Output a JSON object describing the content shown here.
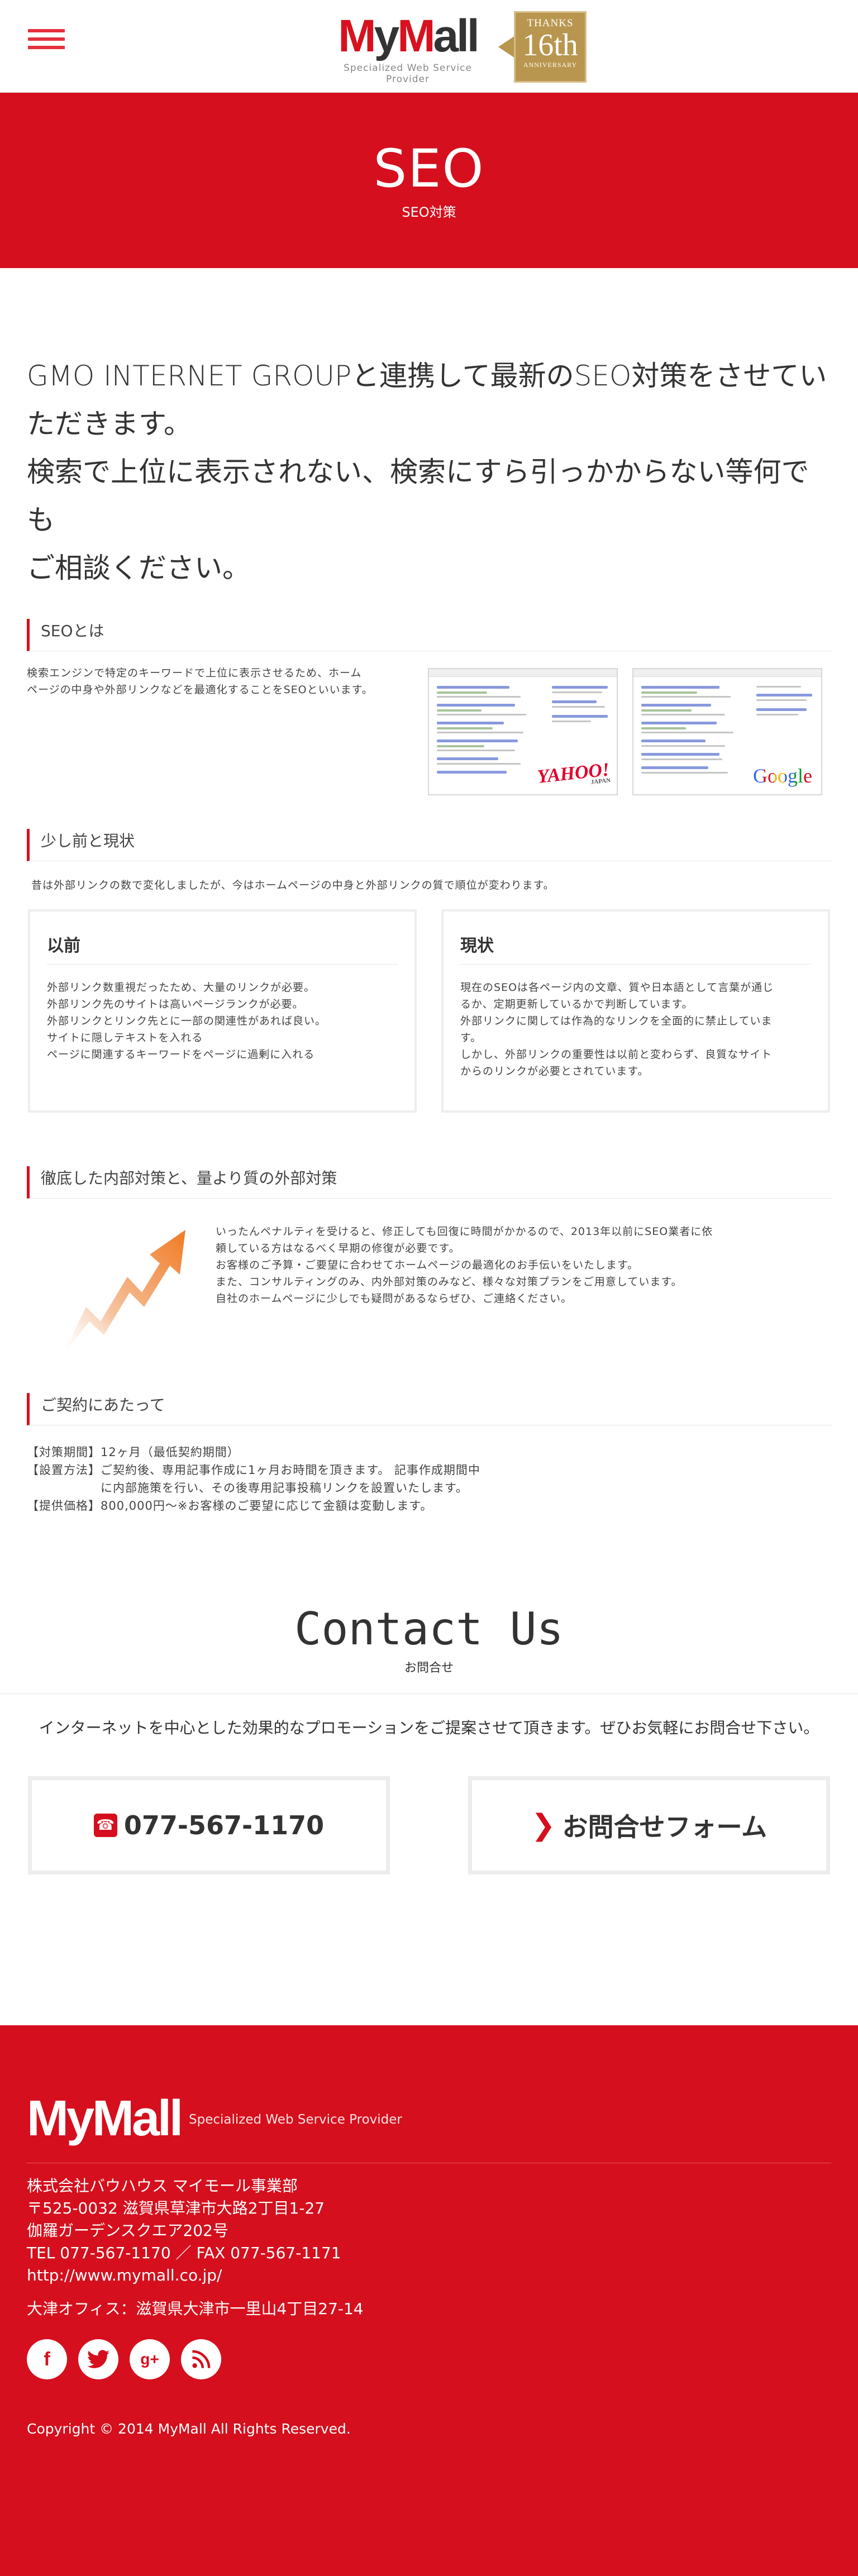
{
  "header": {
    "logo_text": "MyMall",
    "logo_sub": "Specialized Web Service Provider",
    "badge_line1": "THANKS",
    "badge_line2": "16th",
    "badge_line3": "ANNIVERSARY"
  },
  "hero": {
    "title": "SEO",
    "subtitle": "SEO対策"
  },
  "intro": {
    "line1": "GMO INTERNET GROUPと連携して最新のSEO対策をさせてい",
    "line2": "ただきます。",
    "line3": "検索で上位に表示されない、検索にすら引っかからない等何でも",
    "line4": "ご相談ください。"
  },
  "section_seo": {
    "title": "SEOとは",
    "line1": "検索エンジンで特定のキーワードで上位に表示させるため、ホーム",
    "line2": "ページの中身や外部リンクなどを最適化することをSEOといいます。",
    "yahoo_label": "YAHOO!",
    "yahoo_sub": "JAPAN",
    "google_label": "Google"
  },
  "section_now": {
    "title": "少し前と現状",
    "lead": "昔は外部リンクの数で変化しましたが、今はホームページの中身と外部リンクの質で順位が変わります。",
    "before": {
      "title": "以前",
      "lines": [
        "外部リンク数重視だったため、大量のリンクが必要。",
        "外部リンク先のサイトは高いページランクが必要。",
        "外部リンクとリンク先とに一部の関連性があれば良い。",
        "サイトに隠しテキストを入れる",
        "ページに関連するキーワードをページに過剰に入れる"
      ]
    },
    "current": {
      "title": "現状",
      "lines": [
        "現在のSEOは各ページ内の文章、質や日本語として言葉が通じ",
        "るか、定期更新しているかで判断しています。",
        "外部リンクに関しては作為的なリンクを全面的に禁止していま",
        "す。",
        "しかし、外部リンクの重要性は以前と変わらず、良質なサイト",
        "からのリンクが必要とされています。"
      ]
    }
  },
  "section_measures": {
    "title": "徹底した内部対策と、量より質の外部対策",
    "lines": [
      "いったんペナルティを受けると、修正しても回復に時間がかかるので、2013年以前にSEO業者に依",
      "頼している方はなるべく早期の修復が必要です。",
      "お客様のご予算・ご要望に合わせてホームページの最適化のお手伝いをいたします。",
      "また、コンサルティングのみ、内外部対策のみなど、様々な対策プランをご用意しています。",
      "自社のホームページに少しでも疑問があるならぜひ、ご連絡ください。"
    ]
  },
  "section_contract": {
    "title": "ご契約にあたって",
    "lines": [
      "【対策期間】12ヶ月（最低契約期間）",
      "【設置方法】ご契約後、専用記事作成に1ヶ月お時間を頂きます。 記事作成期間中",
      "　　　　　　に内部施策を行い、その後専用記事投稿リンクを設置いたします。",
      "【提供価格】800,000円〜※お客様のご要望に応じて金額は変動します。"
    ]
  },
  "contact": {
    "title": "Contact Us",
    "subtitle": "お問合せ",
    "lead": "インターネットを中心とした効果的なプロモーションをご提案させて頂きます。ぜひお気軽にお問合せ下さい。",
    "phone_label": "077-567-1170",
    "form_label": "お問合せフォーム"
  },
  "footer": {
    "logo_text": "MyMall",
    "tagline": "Specialized Web Service Provider",
    "address": [
      "株式会社バウハウス マイモール事業部",
      "〒525-0032 滋賀県草津市大路2丁目1-27",
      "伽羅ガーデンスクエア202号",
      "TEL 077-567-1170 ／ FAX 077-567-1171",
      "http://www.mymall.co.jp/"
    ],
    "office": "大津オフィス：滋賀県大津市一里山4丁目27-14",
    "copyright": "Copyright © 2014 MyMall All Rights Reserved."
  },
  "colors": {
    "brand_red": "#d50f1d",
    "badge_gold": "#b9964f"
  },
  "icons": [
    "menu-icon",
    "phone-icon",
    "chevron-right-icon",
    "facebook-icon",
    "twitter-icon",
    "google-plus-icon",
    "rss-icon",
    "growth-arrow-icon"
  ]
}
